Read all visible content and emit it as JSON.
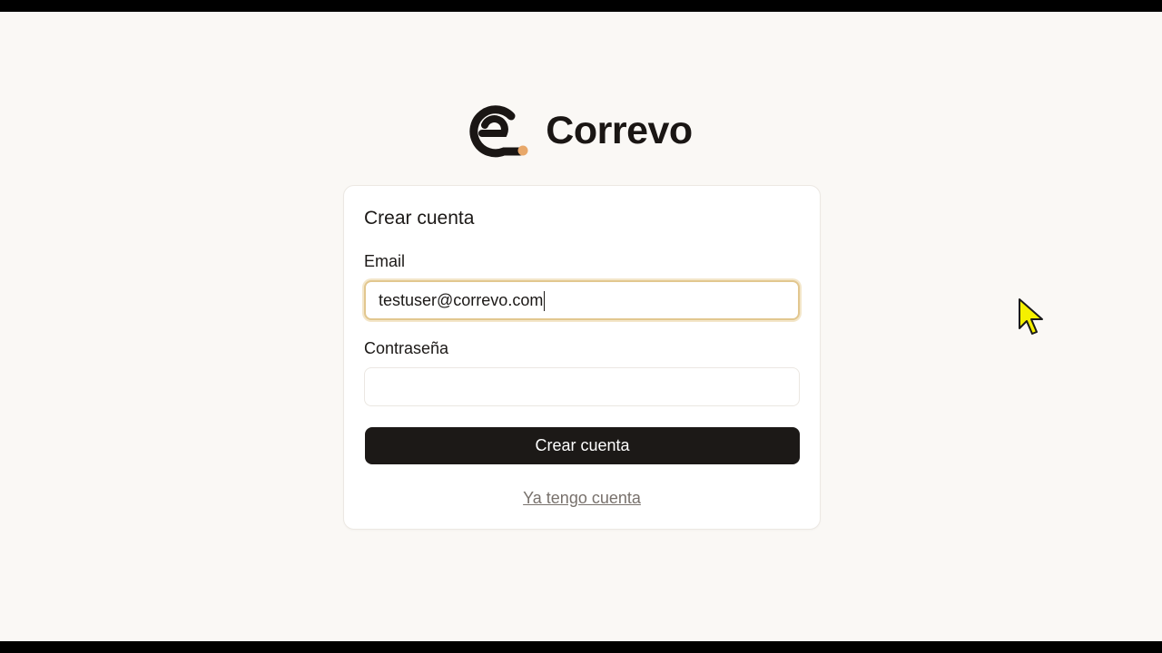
{
  "brand": {
    "name": "Correvo",
    "logo_icon": "correvo-e-logo-icon",
    "logo_color": "#1a1614",
    "logo_accent_color": "#e8a86a"
  },
  "form": {
    "title": "Crear cuenta",
    "email": {
      "label": "Email",
      "value": "testuser@correvo.com"
    },
    "password": {
      "label": "Contraseña",
      "value": ""
    },
    "submit_label": "Crear cuenta",
    "login_link": "Ya tengo cuenta"
  },
  "colors": {
    "background": "#faf8f5",
    "button": "#1c1917",
    "focus_ring": "#e2c78f",
    "cursor": "#f5f000"
  }
}
